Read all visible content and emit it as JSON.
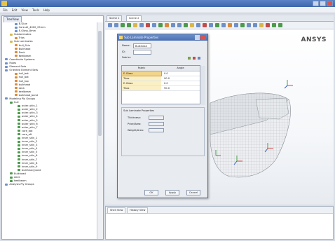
{
  "window": {
    "title_visible": false
  },
  "menubar": {
    "items": [
      "File",
      "Edit",
      "View",
      "Tools",
      "Help"
    ]
  },
  "tree": {
    "tab_label": "TreeView",
    "rows": [
      {
        "label": "B-Glue",
        "indent": 8,
        "icon": "blue"
      },
      {
        "label": "Core-all_4000_25mm",
        "indent": 8,
        "icon": "blue"
      },
      {
        "label": "E-Glass_8mm",
        "indent": 8,
        "icon": "blue"
      },
      {
        "label": "Sublaminates",
        "indent": 5,
        "icon": "yellow"
      },
      {
        "label": "Trias",
        "indent": 8,
        "icon": "orange"
      },
      {
        "label": "Sub Laminates",
        "indent": 5,
        "icon": "yellow"
      },
      {
        "label": "Hull_Skin",
        "indent": 8,
        "icon": "orange"
      },
      {
        "label": "Bulkhead",
        "indent": 8,
        "icon": "orange"
      },
      {
        "label": "Deck",
        "indent": 8,
        "icon": "orange"
      },
      {
        "label": "Keelbeam",
        "indent": 8,
        "icon": "orange"
      },
      {
        "label": "Coordinate Systems",
        "indent": 2,
        "icon": "blue"
      },
      {
        "label": "Rules",
        "indent": 2,
        "icon": "blue"
      },
      {
        "label": "Element Sets",
        "indent": 2,
        "icon": "blue"
      },
      {
        "label": "Oriented Element Sets",
        "indent": 2,
        "icon": "blue"
      },
      {
        "label": "hull_bot",
        "indent": 8,
        "icon": "orange"
      },
      {
        "label": "hull_bot",
        "indent": 8,
        "icon": "orange"
      },
      {
        "label": "hull_top",
        "indent": 8,
        "icon": "orange"
      },
      {
        "label": "bulkhead",
        "indent": 8,
        "icon": "orange"
      },
      {
        "label": "deck",
        "indent": 8,
        "icon": "orange"
      },
      {
        "label": "keelbeam",
        "indent": 8,
        "icon": "orange"
      },
      {
        "label": "bulkhead_bond",
        "indent": 8,
        "icon": "orange"
      },
      {
        "label": "Modeling Ply Groups",
        "indent": 2,
        "icon": "blue"
      },
      {
        "label": "hull",
        "indent": 5,
        "icon": "green"
      },
      {
        "label": "outer_skin_1",
        "indent": 10,
        "icon": "green"
      },
      {
        "label": "outer_skin_2",
        "indent": 10,
        "icon": "green"
      },
      {
        "label": "outer_skin_3",
        "indent": 10,
        "icon": "green"
      },
      {
        "label": "outer_skin_4",
        "indent": 10,
        "icon": "green"
      },
      {
        "label": "outer_skin_5",
        "indent": 10,
        "icon": "green"
      },
      {
        "label": "outer_skin_6",
        "indent": 10,
        "icon": "green"
      },
      {
        "label": "outer_skin_7",
        "indent": 10,
        "icon": "green"
      },
      {
        "label": "core_bot",
        "indent": 10,
        "icon": "green"
      },
      {
        "label": "core_aft",
        "indent": 10,
        "icon": "green"
      },
      {
        "label": "inner_skin_1",
        "indent": 10,
        "icon": "green"
      },
      {
        "label": "inner_skin_2",
        "indent": 10,
        "icon": "green"
      },
      {
        "label": "inner_skin_3",
        "indent": 10,
        "icon": "green"
      },
      {
        "label": "inner_skin_4",
        "indent": 10,
        "icon": "green"
      },
      {
        "label": "inner_skin_5",
        "indent": 10,
        "icon": "green"
      },
      {
        "label": "inner_skin_6",
        "indent": 10,
        "icon": "green"
      },
      {
        "label": "inner_skin_7",
        "indent": 10,
        "icon": "green"
      },
      {
        "label": "inner_skin_8",
        "indent": 10,
        "icon": "green"
      },
      {
        "label": "inner_skin_9",
        "indent": 10,
        "icon": "green"
      },
      {
        "label": "bulkhead_bond",
        "indent": 10,
        "icon": "green"
      },
      {
        "label": "Bulkhead",
        "indent": 5,
        "icon": "green"
      },
      {
        "label": "deck",
        "indent": 5,
        "icon": "green"
      },
      {
        "label": "keelbeam",
        "indent": 5,
        "icon": "green"
      },
      {
        "label": "Analysis Ply Groups",
        "indent": 2,
        "icon": "blue"
      }
    ]
  },
  "editor_tabs": [
    "Scene 1",
    "Scene 2"
  ],
  "viewport": {
    "logo": "ANSYS"
  },
  "bottom_tabs": [
    "Shell View",
    "History View"
  ],
  "dialog": {
    "title": "Sub Laminate Properties",
    "name_label": "Name:",
    "name_value": "Bulkhead",
    "id_label": "ID:",
    "id_value": "",
    "fabrics_label": "Fabrics",
    "col_fabric": "Fabric",
    "col_angle": "Angle",
    "rows": [
      {
        "fabric": "E-Glass",
        "angle": "0.0"
      },
      {
        "fabric": "Triax",
        "angle": "90.0"
      },
      {
        "fabric": "E-Glass",
        "angle": "0.0"
      },
      {
        "fabric": "Triax",
        "angle": "90.0"
      }
    ],
    "props_label": "Sub Laminate Properties",
    "thickness_label": "Thickness:",
    "price_label": "Price/Area:",
    "weight_label": "Weight/Area:",
    "ok_label": "OK",
    "apply_label": "Apply",
    "cancel_label": "Cancel"
  },
  "colors": {
    "titlebar": "#4a6fb0",
    "accent": "#f3d58a"
  }
}
